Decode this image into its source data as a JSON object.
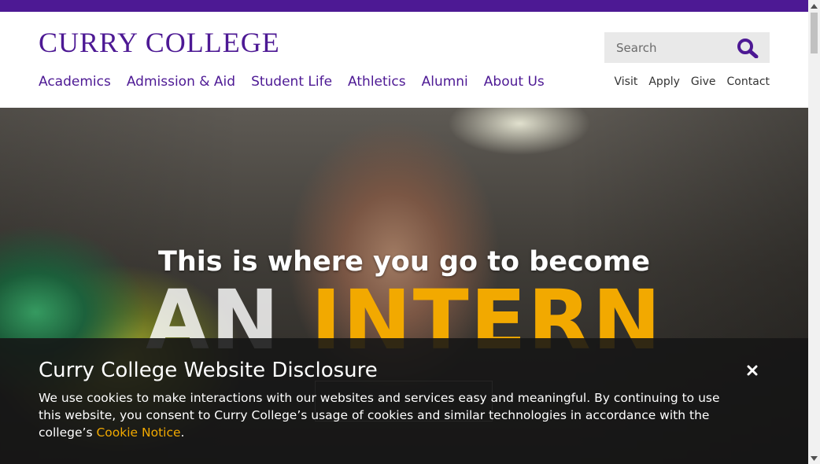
{
  "header": {
    "logo_text": "CURRY COLLEGE",
    "search": {
      "placeholder": "Search",
      "icon": "search-icon"
    },
    "main_nav": [
      {
        "label": "Academics"
      },
      {
        "label": "Admission & Aid"
      },
      {
        "label": "Student Life"
      },
      {
        "label": "Athletics"
      },
      {
        "label": "Alumni"
      },
      {
        "label": "About Us"
      }
    ],
    "utility_nav": [
      {
        "label": "Visit"
      },
      {
        "label": "Apply"
      },
      {
        "label": "Give"
      },
      {
        "label": "Contact"
      }
    ]
  },
  "hero": {
    "headline": "This is where you go to become",
    "word_part1": "AN",
    "word_part2": "INTERN"
  },
  "cookie_banner": {
    "title": "Curry College Website Disclosure",
    "body": "We use cookies to make interactions with our websites and services easy and meaningful. By continuing to use this website, you consent to Curry College’s usage of cookies and similar technologies in accordance with the college’s",
    "link_text": "Cookie Notice",
    "trailing": ".",
    "close_icon": "close-icon"
  },
  "colors": {
    "brand_purple": "#4d1994",
    "accent_gold": "#f2a900",
    "banner_bg": "#161616"
  }
}
